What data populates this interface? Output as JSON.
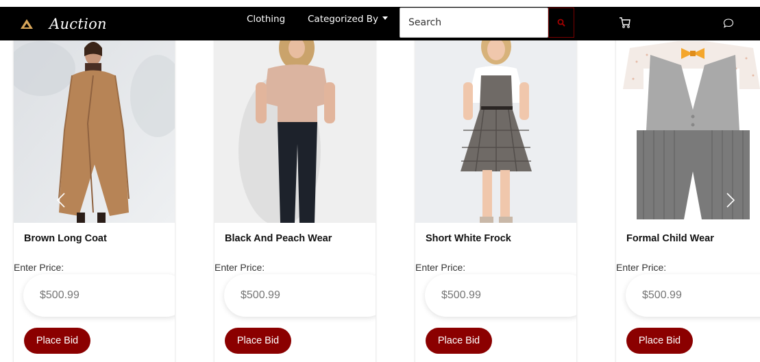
{
  "navbar": {
    "brand": "Auction",
    "links": [
      "Clothing",
      "Categorized By"
    ],
    "search_placeholder": "Search"
  },
  "products": [
    {
      "title": "Brown Long Coat",
      "price_label": "Enter Price:",
      "price_placeholder": "$500.99",
      "button": "Place Bid"
    },
    {
      "title": "Black And Peach Wear",
      "price_label": "Enter Price:",
      "price_placeholder": "$500.99",
      "button": "Place Bid"
    },
    {
      "title": "Short White Frock",
      "price_label": "Enter Price:",
      "price_placeholder": "$500.99",
      "button": "Place Bid"
    },
    {
      "title": "Formal Child Wear",
      "price_label": "Enter Price:",
      "price_placeholder": "$500.99",
      "button": "Place Bid"
    }
  ],
  "colors": {
    "navbar_bg": "#000000",
    "accent": "#8b0000",
    "brand_logo": "#d9a75b"
  },
  "icons": [
    "logo-icon",
    "search-icon",
    "cart-icon",
    "chat-icon",
    "chevron-left-icon",
    "chevron-right-icon"
  ]
}
